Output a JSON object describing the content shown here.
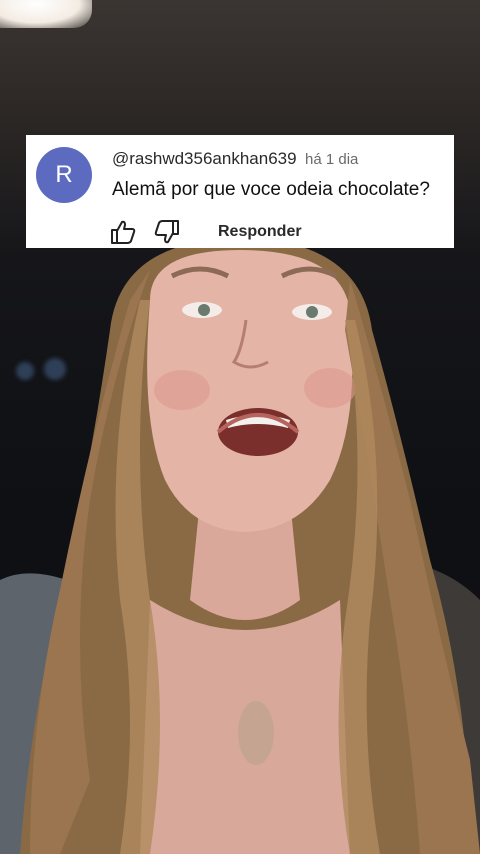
{
  "comment": {
    "avatar_letter": "R",
    "avatar_color": "#5c6bc0",
    "handle": "@rashwd356ankhan639",
    "time": "há 1 dia",
    "text": "Alemã por que voce odeia chocolate?",
    "reply_label": "Responder"
  },
  "icons": {
    "like": "thumbs-up-icon",
    "dislike": "thumbs-down-icon"
  }
}
